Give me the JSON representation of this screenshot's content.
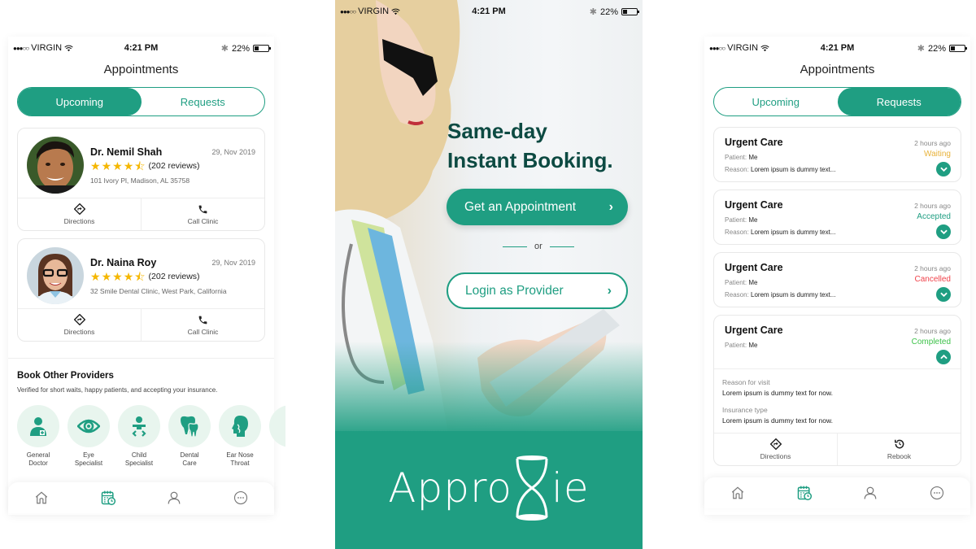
{
  "colors": {
    "brand": "#1f9e82",
    "headline": "#0d4a42",
    "star": "#f5b700",
    "waiting": "#e8b23a",
    "accepted": "#1f9e82",
    "cancelled": "#f0434b",
    "completed": "#3ec24a"
  },
  "statusbar": {
    "signal_dots": "●●●○○",
    "carrier": "VIRGIN",
    "time": "4:21 PM",
    "bluetooth_icon": "bluetooth-icon",
    "battery": "22%"
  },
  "left_screen": {
    "title": "Appointments",
    "tabs": [
      {
        "label": "Upcoming",
        "active": true
      },
      {
        "label": "Requests",
        "active": false
      }
    ],
    "appointments": [
      {
        "doctor": "Dr. Nemil Shah",
        "date": "29, Nov 2019",
        "rating": 4.5,
        "rating_max": 5,
        "reviews": "(202 reviews)",
        "address": "101 Ivory Pl, Madison, AL 35758",
        "actions": [
          {
            "label": "Directions",
            "icon": "directions-icon"
          },
          {
            "label": "Call Clinic",
            "icon": "phone-icon"
          }
        ]
      },
      {
        "doctor": "Dr. Naina Roy",
        "date": "29, Nov 2019",
        "rating": 4.5,
        "rating_max": 5,
        "reviews": "(202 reviews)",
        "address": "32 Smile Dental Clinic, West Park, California",
        "actions": [
          {
            "label": "Directions",
            "icon": "directions-icon"
          },
          {
            "label": "Call Clinic",
            "icon": "phone-icon"
          }
        ]
      }
    ],
    "book_other": {
      "title": "Book Other Providers",
      "subtitle": "Verified for short waits, happy patients, and accepting your insurance.",
      "providers": [
        {
          "line1": "General",
          "line2": "Doctor",
          "icon": "doctor-icon"
        },
        {
          "line1": "Eye",
          "line2": "Specialist",
          "icon": "eye-icon"
        },
        {
          "line1": "Child",
          "line2": "Specialist",
          "icon": "baby-icon"
        },
        {
          "line1": "Dental",
          "line2": "Care",
          "icon": "tooth-icon"
        },
        {
          "line1": "Ear Nose",
          "line2": "Throat",
          "icon": "ent-icon"
        }
      ]
    },
    "tabbar": [
      {
        "name": "home",
        "icon": "home-icon",
        "active": false
      },
      {
        "name": "appointments",
        "icon": "calendar-icon",
        "active": true
      },
      {
        "name": "profile",
        "icon": "user-icon",
        "active": false
      },
      {
        "name": "more",
        "icon": "more-icon",
        "active": false
      }
    ]
  },
  "center_screen": {
    "headline_line1": "Same-day",
    "headline_line2": "Instant Booking.",
    "primary_button": "Get an Appointment",
    "or_text": "or",
    "secondary_button": "Login as Provider",
    "chevron": "›",
    "logo_left": "Appro",
    "logo_right": "ie"
  },
  "right_screen": {
    "title": "Appointments",
    "tabs": [
      {
        "label": "Upcoming",
        "active": false
      },
      {
        "label": "Requests",
        "active": true
      }
    ],
    "requests": [
      {
        "title": "Urgent Care",
        "patient_label": "Patient:",
        "patient": "Me",
        "reason_label": "Reason:",
        "reason": "Lorem ipsum is dummy text...",
        "time": "2 hours ago",
        "status": "Waiting",
        "expanded": false
      },
      {
        "title": "Urgent Care",
        "patient_label": "Patient:",
        "patient": "Me",
        "reason_label": "Reason:",
        "reason": "Lorem ipsum is dummy text...",
        "time": "2 hours ago",
        "status": "Accepted",
        "expanded": false
      },
      {
        "title": "Urgent Care",
        "patient_label": "Patient:",
        "patient": "Me",
        "reason_label": "Reason:",
        "reason": "Lorem ipsum is dummy text...",
        "time": "2 hours ago",
        "status": "Cancelled",
        "expanded": false
      },
      {
        "title": "Urgent Care",
        "patient_label": "Patient:",
        "patient": "Me",
        "time": "2 hours ago",
        "status": "Completed",
        "expanded": true,
        "reason_for_visit_label": "Reason for visit",
        "reason_for_visit": "Lorem ipsum is dummy text for now.",
        "insurance_label": "Insurance type",
        "insurance": "Lorem ipsum is dummy text for now.",
        "actions": [
          {
            "label": "Directions",
            "icon": "directions-icon"
          },
          {
            "label": "Rebook",
            "icon": "rebook-icon"
          }
        ]
      }
    ],
    "tabbar": [
      {
        "name": "home",
        "icon": "home-icon",
        "active": false
      },
      {
        "name": "appointments",
        "icon": "calendar-icon",
        "active": true
      },
      {
        "name": "profile",
        "icon": "user-icon",
        "active": false
      },
      {
        "name": "more",
        "icon": "more-icon",
        "active": false
      }
    ]
  }
}
